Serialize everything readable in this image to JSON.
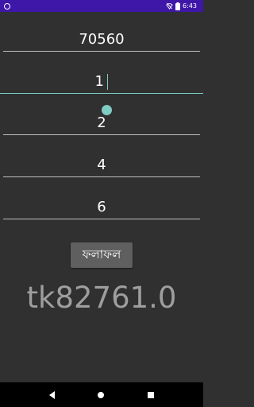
{
  "status_bar": {
    "time": "6:43",
    "icons": [
      "app-notification-icon",
      "wifi-off-icon",
      "battery-icon"
    ]
  },
  "inputs": [
    {
      "value": "70560"
    },
    {
      "value": "1"
    },
    {
      "value": "2"
    },
    {
      "value": "4"
    },
    {
      "value": "6"
    }
  ],
  "result_button": {
    "label": "ফলাফল"
  },
  "result": {
    "text": "tk82761.0"
  },
  "nav_bar": {
    "icons": [
      "back-icon",
      "home-icon",
      "recents-icon"
    ]
  },
  "colors": {
    "status_bar": "#3f17a8",
    "background": "#303030",
    "accent": "#80cbc4",
    "result_text": "#9e9e9e",
    "button": "#5f5f5f"
  }
}
